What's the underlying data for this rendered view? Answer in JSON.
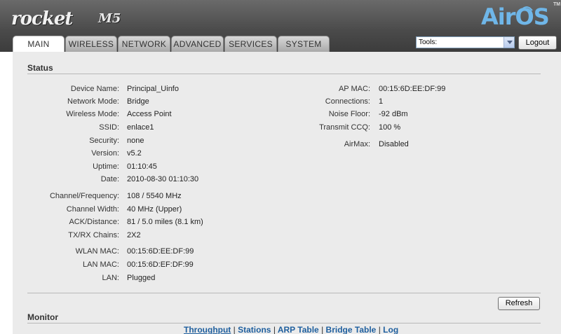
{
  "header": {
    "brand": "rocket",
    "model": "M5",
    "os_logo": "AirOS",
    "tm": "TM"
  },
  "tabs": [
    {
      "label": "MAIN",
      "active": true
    },
    {
      "label": "WIRELESS",
      "active": false
    },
    {
      "label": "NETWORK",
      "active": false
    },
    {
      "label": "ADVANCED",
      "active": false
    },
    {
      "label": "SERVICES",
      "active": false
    },
    {
      "label": "SYSTEM",
      "active": false
    }
  ],
  "tools": {
    "selected": "Tools:",
    "logout_label": "Logout"
  },
  "status": {
    "title": "Status",
    "left": [
      {
        "label": "Device Name:",
        "value": "Principal_Uinfo"
      },
      {
        "label": "Network Mode:",
        "value": "Bridge"
      },
      {
        "label": "Wireless Mode:",
        "value": "Access Point"
      },
      {
        "label": "SSID:",
        "value": "enlace1"
      },
      {
        "label": "Security:",
        "value": "none"
      },
      {
        "label": "Version:",
        "value": "v5.2"
      },
      {
        "label": "Uptime:",
        "value": "01:10:45"
      },
      {
        "label": "Date:",
        "value": "2010-08-30 01:10:30"
      },
      {
        "label": "Channel/Frequency:",
        "value": "108 / 5540 MHz"
      },
      {
        "label": "Channel Width:",
        "value": "40 MHz (Upper)"
      },
      {
        "label": "ACK/Distance:",
        "value": "81 / 5.0 miles (8.1 km)"
      },
      {
        "label": "TX/RX Chains:",
        "value": "2X2"
      },
      {
        "label": "WLAN MAC:",
        "value": "00:15:6D:EE:DF:99"
      },
      {
        "label": "LAN MAC:",
        "value": "00:15:6D:EF:DF:99"
      },
      {
        "label": "LAN:",
        "value": "Plugged"
      }
    ],
    "right": [
      {
        "label": "AP MAC:",
        "value": "00:15:6D:EE:DF:99"
      },
      {
        "label": "Connections:",
        "value": "1"
      },
      {
        "label": "Noise Floor:",
        "value": "-92 dBm"
      },
      {
        "label": "Transmit CCQ:",
        "value": "100 %"
      },
      {
        "label": "AirMax:",
        "value": "Disabled"
      }
    ]
  },
  "refresh_label": "Refresh",
  "monitor": {
    "title": "Monitor",
    "links": [
      "Throughput",
      "Stations",
      "ARP Table",
      "Bridge Table",
      "Log"
    ],
    "separator": "|"
  }
}
